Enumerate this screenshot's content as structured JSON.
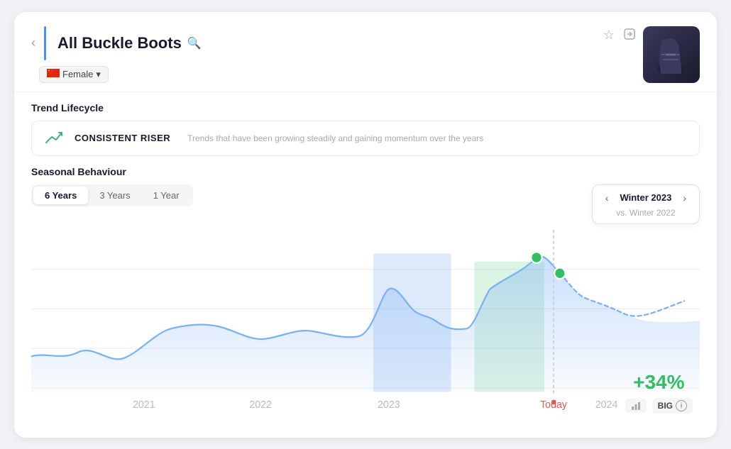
{
  "header": {
    "title": "All Buckle Boots",
    "back_label": "‹",
    "search_icon": "🔍",
    "favorite_icon": "☆",
    "share_icon": "⊡",
    "filter": {
      "gender": "Female",
      "flag": "🇨🇳"
    }
  },
  "trend_lifecycle": {
    "section_label": "Trend Lifecycle",
    "badge": "CONSISTENT RISER",
    "description": "Trends that have been growing steadily and gaining momentum over the years"
  },
  "seasonal": {
    "section_label": "Seasonal Behaviour",
    "tabs": [
      {
        "label": "6 Years",
        "active": true
      },
      {
        "label": "3 Years",
        "active": false
      },
      {
        "label": "1 Year",
        "active": false
      }
    ],
    "winter_selector": {
      "label": "Winter 2023",
      "vs_label": "vs. Winter 2022"
    }
  },
  "metric": {
    "value": "+34%",
    "badge_label": "BIG"
  },
  "x_axis_labels": [
    "2021",
    "2022",
    "2023",
    "Today",
    "2024"
  ],
  "colors": {
    "accent_blue": "#7ab0f5",
    "accent_green": "#2ec063",
    "chart_fill": "rgba(120,170,240,0.3)",
    "green_fill": "rgba(80,200,120,0.25)"
  }
}
